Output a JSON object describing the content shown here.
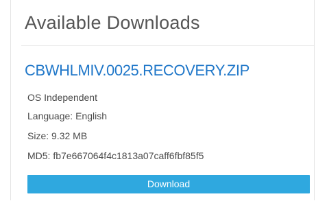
{
  "section": {
    "title": "Available Downloads"
  },
  "file": {
    "name": "CBWHLMIV.0025.RECOVERY.ZIP",
    "os": "OS Independent",
    "language": "Language: English",
    "size": "Size: 9.32 MB",
    "md5": "MD5: fb7e667064f4c1813a07caff6fbf85f5"
  },
  "actions": {
    "download_label": "Download"
  },
  "colors": {
    "accent_button": "#2fa8df",
    "link": "#2178c9",
    "heading": "#555555",
    "body_text": "#4a4a4a"
  }
}
